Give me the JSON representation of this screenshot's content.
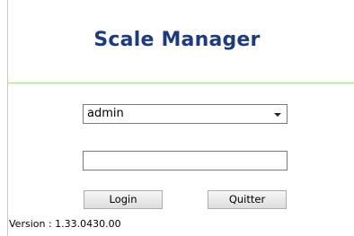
{
  "app": {
    "title": "Scale Manager"
  },
  "login_form": {
    "user_select": {
      "selected_value": "admin"
    },
    "password_field": {
      "value": ""
    },
    "login_button_label": "Login",
    "quit_button_label": "Quitter"
  },
  "footer": {
    "version_text": "Version : 1.33.0430.00"
  },
  "colors": {
    "title_color": "#1f3a7a",
    "divider_color": "#a9d98a"
  },
  "icons": {
    "select_arrow": "chevron-down-icon"
  }
}
